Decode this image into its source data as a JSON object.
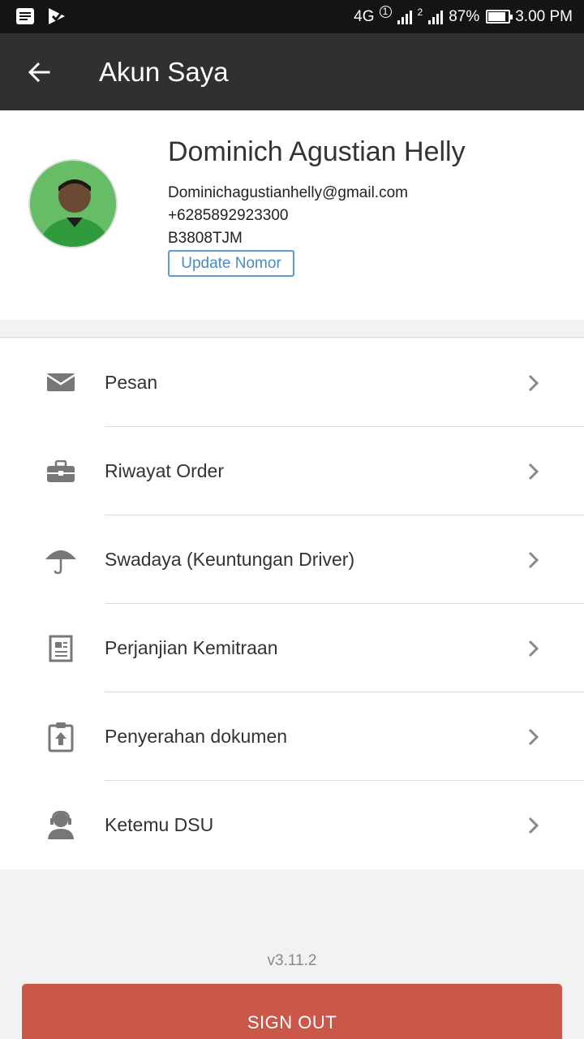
{
  "status_bar": {
    "network": "4G",
    "sim1": "1",
    "sim2": "2",
    "battery_percent": "87%",
    "battery_level": 0.87,
    "time": "3.00 PM",
    "left_icons": [
      "notification-icon",
      "play-store-icon"
    ]
  },
  "app_bar": {
    "title": "Akun Saya",
    "back_icon": "arrow-left-icon"
  },
  "profile": {
    "name": "Dominich Agustian Helly",
    "email": "Dominichagustianhelly@gmail.com",
    "phone": "+6285892923300",
    "plate": "B3808TJM",
    "update_button": "Update Nomor",
    "avatar_accent": "#3fa648"
  },
  "menu": {
    "items": [
      {
        "label": "Pesan",
        "icon": "mail-icon"
      },
      {
        "label": "Riwayat Order",
        "icon": "briefcase-icon"
      },
      {
        "label": "Swadaya (Keuntungan Driver)",
        "icon": "umbrella-icon"
      },
      {
        "label": "Perjanjian Kemitraan",
        "icon": "document-icon"
      },
      {
        "label": "Penyerahan dokumen",
        "icon": "clipboard-upload-icon"
      },
      {
        "label": "Ketemu DSU",
        "icon": "headset-user-icon"
      }
    ]
  },
  "footer": {
    "version": "v3.11.2",
    "signout_label": "SIGN OUT"
  },
  "colors": {
    "app_bar": "#303030",
    "accent_blue": "#4a8ac8",
    "signout": "#c9574a",
    "icon_gray": "#777777"
  }
}
